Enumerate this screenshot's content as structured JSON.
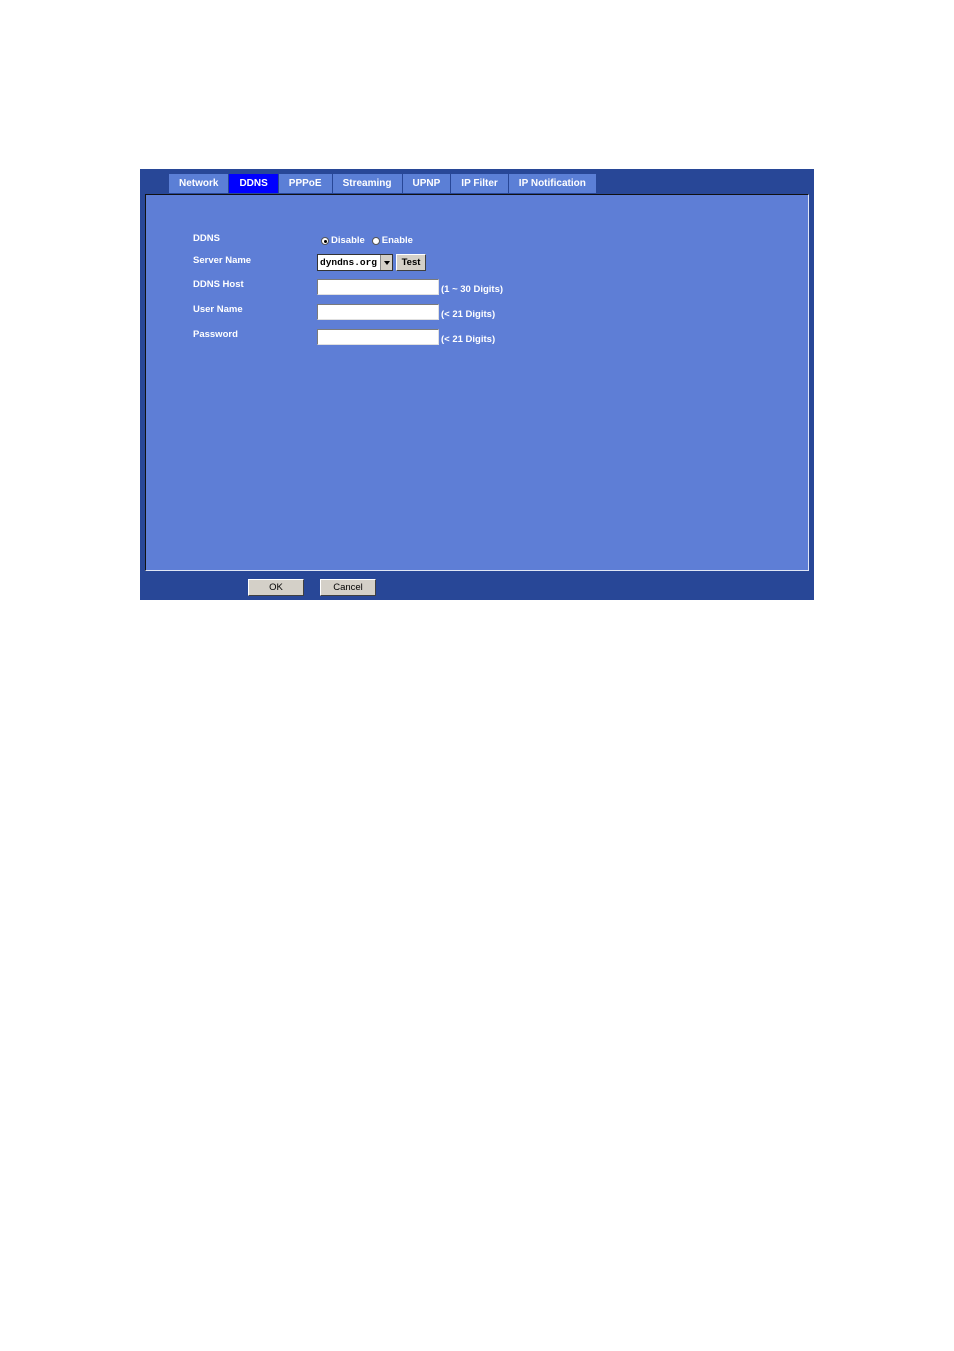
{
  "tabs": [
    {
      "label": "Network",
      "active": false
    },
    {
      "label": "DDNS",
      "active": true
    },
    {
      "label": "PPPoE",
      "active": false
    },
    {
      "label": "Streaming",
      "active": false
    },
    {
      "label": "UPNP",
      "active": false
    },
    {
      "label": "IP Filter",
      "active": false
    },
    {
      "label": "IP Notification",
      "active": false
    }
  ],
  "form": {
    "ddns": {
      "label": "DDNS",
      "options": [
        "Disable",
        "Enable"
      ],
      "selected": "Disable"
    },
    "server_name": {
      "label": "Server Name",
      "value": "dyndns.org",
      "test_label": "Test"
    },
    "ddns_host": {
      "label": "DDNS Host",
      "value": "",
      "hint": "(1 ~ 30 Digits)"
    },
    "user_name": {
      "label": "User Name",
      "value": "",
      "hint": "(< 21 Digits)"
    },
    "password": {
      "label": "Password",
      "value": "",
      "hint": "(< 21 Digits)"
    }
  },
  "footer": {
    "ok_label": "OK",
    "cancel_label": "Cancel"
  }
}
